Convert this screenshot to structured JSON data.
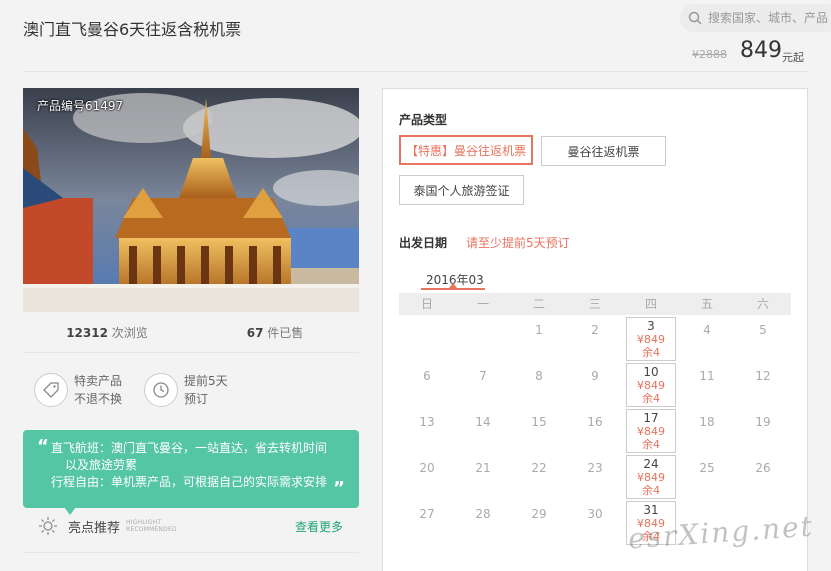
{
  "title": "澳门直飞曼谷6天往返含税机票",
  "search": {
    "placeholder": "搜索国家、城市、产品"
  },
  "price": {
    "original": "¥2888",
    "current": "849",
    "unit": "元起"
  },
  "product": {
    "number_label": "产品编号61497",
    "views_count": "12312",
    "views_label": "次浏览",
    "sold_count": "67",
    "sold_label": "件已售"
  },
  "features": [
    {
      "icon": "tag-icon",
      "line1": "特卖产品",
      "line2": "不退不换"
    },
    {
      "icon": "clock-icon",
      "line1": "提前5天",
      "line2": "预订"
    }
  ],
  "highlights": {
    "line1": "直飞航班：澳门直飞曼谷，一站直达，省去转机时间",
    "line2": "以及旅途劳累",
    "line3": "行程自由：单机票产品，可根据自己的实际需求安排",
    "title": "亮点推荐",
    "title_en_1": "HIGHLIGHT",
    "title_en_2": "RECOMMENDED",
    "more": "查看更多"
  },
  "booking": {
    "product_type_label": "产品类型",
    "options": [
      {
        "label": "【特惠】曼谷往返机票",
        "selected": true
      },
      {
        "label": "曼谷往返机票",
        "selected": false
      },
      {
        "label": "泰国个人旅游签证",
        "selected": false
      }
    ],
    "date_label": "出发日期",
    "date_hint": "请至少提前5天预订",
    "month": "2016年03"
  },
  "calendar": {
    "weekdays": [
      "日",
      "一",
      "二",
      "三",
      "四",
      "五",
      "六"
    ],
    "rows": [
      [
        "",
        "",
        "1",
        "2",
        "3",
        "4",
        "5"
      ],
      [
        "6",
        "7",
        "8",
        "9",
        "10",
        "11",
        "12"
      ],
      [
        "13",
        "14",
        "15",
        "16",
        "17",
        "18",
        "19"
      ],
      [
        "20",
        "21",
        "22",
        "23",
        "24",
        "25",
        "26"
      ],
      [
        "27",
        "28",
        "29",
        "30",
        "31",
        "",
        ""
      ]
    ],
    "available": {
      "3": {
        "price": "¥849",
        "remain": "余4"
      },
      "10": {
        "price": "¥849",
        "remain": "余4"
      },
      "17": {
        "price": "¥849",
        "remain": "余4"
      },
      "24": {
        "price": "¥849",
        "remain": "余4"
      },
      "31": {
        "price": "¥849",
        "remain": "余4"
      }
    }
  },
  "watermark": "esrXing.net",
  "colors": {
    "accent": "#e8735e",
    "green": "#55c6a4",
    "link": "#22a37a"
  }
}
